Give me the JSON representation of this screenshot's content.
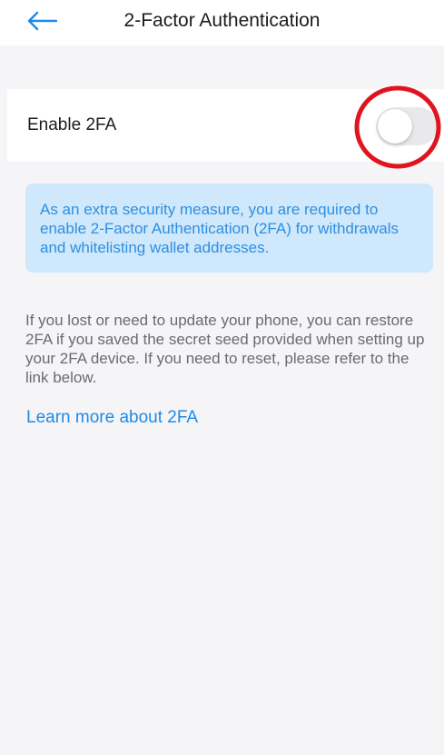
{
  "header": {
    "back_icon": "arrow-left-icon",
    "title": "2-Factor Authentication"
  },
  "two_fa": {
    "label": "Enable 2FA",
    "enabled": false
  },
  "info": {
    "text": "As an extra security measure, you are required to enable 2-Factor Authentication (2FA) for withdrawals and whitelisting wallet addresses."
  },
  "description": "If you lost or need to update your phone, you can restore 2FA if you saved the secret seed provided when setting up your 2FA device. If you need to reset, please refer to the link below.",
  "link": {
    "label": "Learn more about 2FA"
  },
  "colors": {
    "accent": "#1f8ae8",
    "info_bg": "#cfe8fb",
    "highlight": "#e0141f"
  }
}
